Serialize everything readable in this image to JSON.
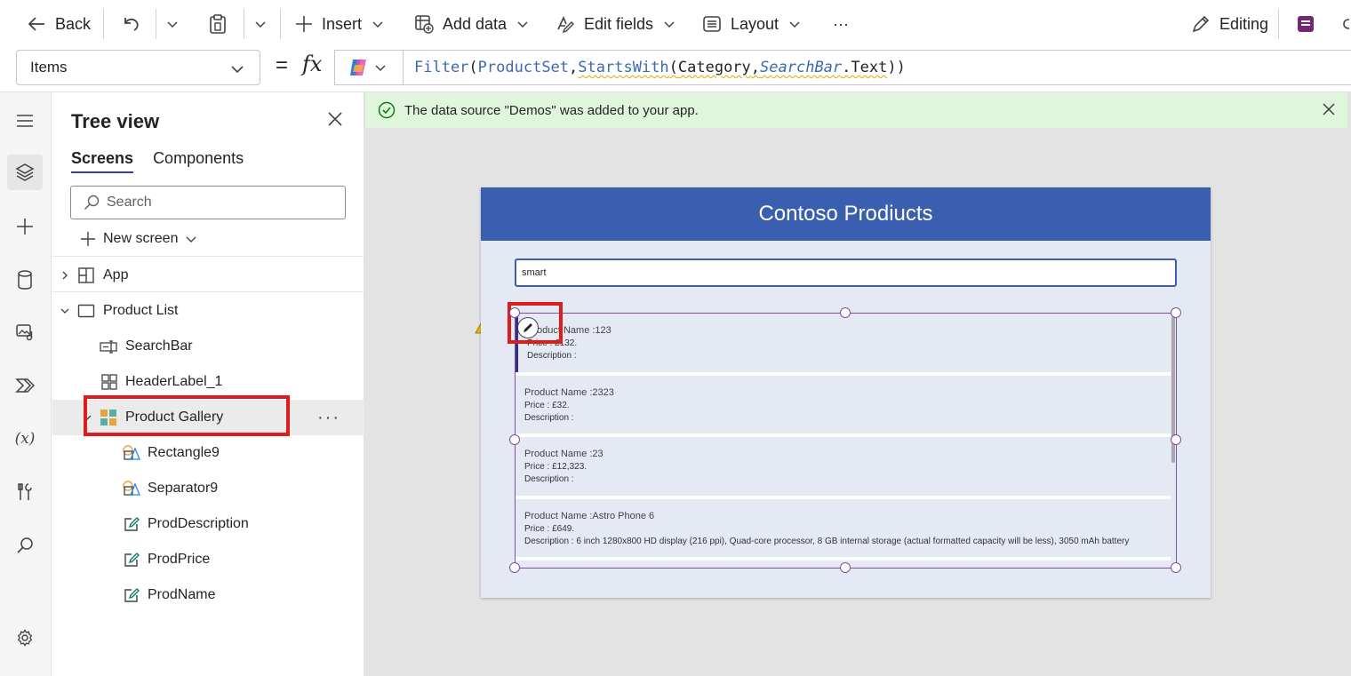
{
  "toolbar": {
    "back_label": "Back",
    "insert_label": "Insert",
    "add_data_label": "Add data",
    "edit_fields_label": "Edit fields",
    "layout_label": "Layout",
    "more_label": "···",
    "editing_label": "Editing"
  },
  "formula_bar": {
    "property": "Items",
    "equals": "=",
    "fx": "fx",
    "formula": {
      "fn_filter": "Filter",
      "open1": "(",
      "source": "ProductSet",
      "comma1": ",",
      "fn_startswith": "StartsWith",
      "open2": "(",
      "column": "Category",
      "comma2": ",",
      "control": "SearchBar",
      "prop": ".Text",
      "close": "))"
    }
  },
  "tree_view": {
    "title": "Tree view",
    "tabs": [
      "Screens",
      "Components"
    ],
    "search_placeholder": "Search",
    "new_screen_label": "New screen",
    "nodes": [
      {
        "label": "App",
        "icon": "app-icon"
      },
      {
        "label": "Product List",
        "icon": "screen-icon"
      },
      {
        "label": "SearchBar",
        "icon": "text-input-icon"
      },
      {
        "label": "HeaderLabel_1",
        "icon": "label-icon"
      },
      {
        "label": "Product Gallery",
        "icon": "gallery-icon"
      },
      {
        "label": "Rectangle9",
        "icon": "shape-icon"
      },
      {
        "label": "Separator9",
        "icon": "shape-icon"
      },
      {
        "label": "ProdDescription",
        "icon": "edit-label-icon"
      },
      {
        "label": "ProdPrice",
        "icon": "edit-label-icon"
      },
      {
        "label": "ProdName",
        "icon": "edit-label-icon"
      }
    ],
    "more_label": "···"
  },
  "banner": {
    "message": "The data source \"Demos\" was added to your app."
  },
  "app": {
    "header_title": "Contoso Prodiucts",
    "search_value": "smart",
    "gallery_items": [
      {
        "name": "Product Name :123",
        "price": "Price :  £132.",
        "description": "Description  :"
      },
      {
        "name": "Product Name :2323",
        "price": "Price :  £32.",
        "description": "Description  :"
      },
      {
        "name": "Product Name :23",
        "price": "Price :  £12,323.",
        "description": "Description  :"
      },
      {
        "name": "Product Name :Astro Phone 6",
        "price": "Price :  £649.",
        "description": "Description  :  6 inch 1280x800 HD display (216 ppi), Quad-core processor, 8 GB internal storage (actual formatted capacity will be less), 3050 mAh battery"
      }
    ]
  },
  "colors": {
    "header_blue": "#3a5fb1",
    "screen_bg": "#e4e9f3",
    "banner_bg": "#dff6dd",
    "highlight_red": "#dd1c1c",
    "selection_purple": "#7d4f9e"
  }
}
